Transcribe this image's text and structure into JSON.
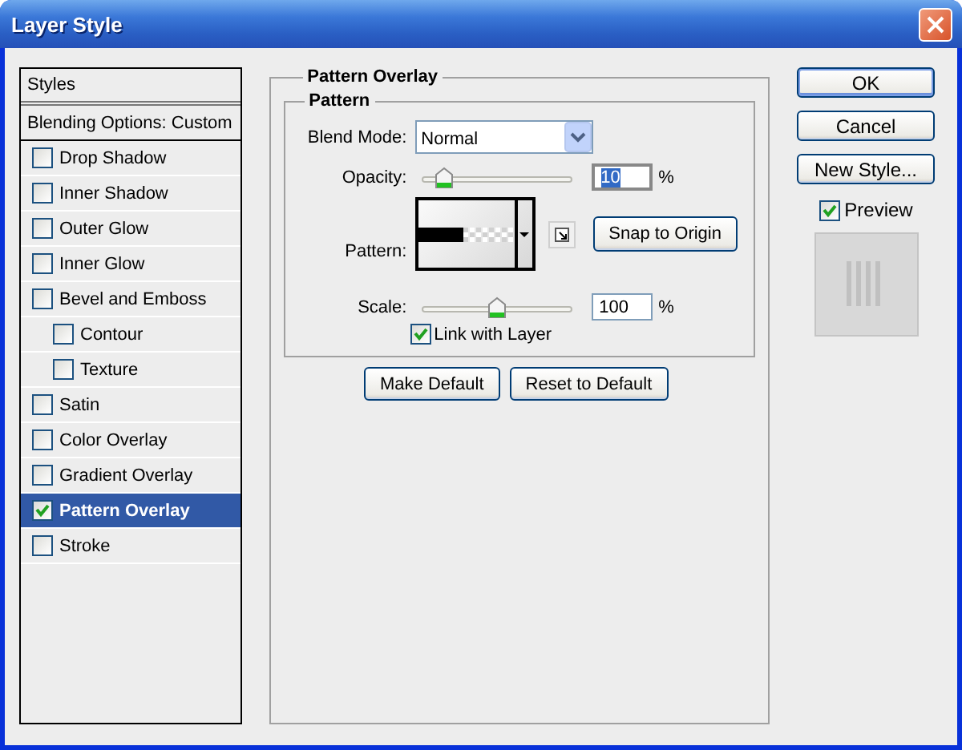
{
  "window": {
    "title": "Layer Style"
  },
  "sidebar": {
    "header": "Styles",
    "blending_options": "Blending Options: Custom",
    "items": [
      {
        "label": "Drop Shadow",
        "checked": false,
        "selected": false
      },
      {
        "label": "Inner Shadow",
        "checked": false,
        "selected": false
      },
      {
        "label": "Outer Glow",
        "checked": false,
        "selected": false
      },
      {
        "label": "Inner Glow",
        "checked": false,
        "selected": false
      },
      {
        "label": "Bevel and Emboss",
        "checked": false,
        "selected": false,
        "children": [
          {
            "label": "Contour",
            "checked": false,
            "selected": false
          },
          {
            "label": "Texture",
            "checked": false,
            "selected": false
          }
        ]
      },
      {
        "label": "Satin",
        "checked": false,
        "selected": false
      },
      {
        "label": "Color Overlay",
        "checked": false,
        "selected": false
      },
      {
        "label": "Gradient Overlay",
        "checked": false,
        "selected": false
      },
      {
        "label": "Pattern Overlay",
        "checked": true,
        "selected": true
      },
      {
        "label": "Stroke",
        "checked": false,
        "selected": false
      }
    ]
  },
  "panel": {
    "title": "Pattern Overlay",
    "group_title": "Pattern",
    "blend_mode": {
      "label": "Blend Mode:",
      "value": "Normal"
    },
    "opacity": {
      "label": "Opacity:",
      "level": 0.1,
      "value": "10",
      "highlighted": true,
      "unit": "%"
    },
    "pattern": {
      "label": "Pattern:"
    },
    "snap_button": "Snap to Origin",
    "scale": {
      "label": "Scale:",
      "level": 0.5,
      "value": "100",
      "highlighted": false,
      "unit": "%"
    },
    "link_with_layer": {
      "label": "Link with Layer",
      "checked": true
    },
    "buttons": [
      "Make Default",
      "Reset to Default"
    ]
  },
  "actions": {
    "buttons": [
      {
        "label": "OK",
        "default": true
      },
      {
        "label": "Cancel",
        "default": false
      },
      {
        "label": "New Style...",
        "default": false
      }
    ],
    "preview": {
      "label": "Preview",
      "checked": true
    }
  }
}
